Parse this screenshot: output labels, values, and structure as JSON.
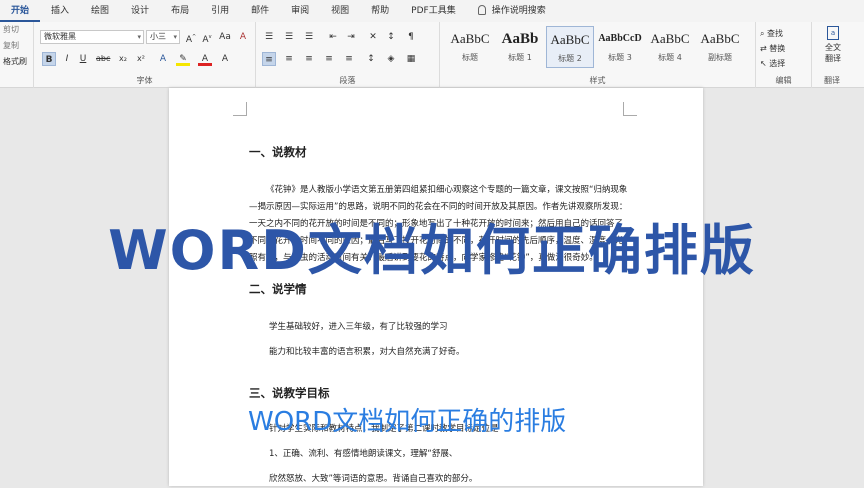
{
  "tabs": [
    "开始",
    "插入",
    "绘图",
    "设计",
    "布局",
    "引用",
    "邮件",
    "审阅",
    "视图",
    "帮助",
    "PDF工具集",
    "操作说明搜索"
  ],
  "clipboard": {
    "cut": "剪切",
    "copy": "复制",
    "format_painter": "格式刷"
  },
  "font": {
    "name": "微软雅黑",
    "size": "小三",
    "group_label": "字体"
  },
  "paragraph": {
    "group_label": "段落"
  },
  "styles": {
    "group_label": "样式",
    "items": [
      {
        "sample": "AaBbC",
        "name": "标题"
      },
      {
        "sample": "AaBb",
        "name": "标题 1"
      },
      {
        "sample": "AaBbC",
        "name": "标题 2"
      },
      {
        "sample": "AaBbCcD",
        "name": "标题 3"
      },
      {
        "sample": "AaBbC",
        "name": "标题 4"
      },
      {
        "sample": "AaBbC",
        "name": "副标题"
      }
    ]
  },
  "editing": {
    "find": "查找",
    "replace": "替换",
    "select": "选择",
    "group_label": "编辑"
  },
  "translate": {
    "label1": "全文",
    "label2": "翻译",
    "group_label": "翻译"
  },
  "document": {
    "h1": "一、说教材",
    "p1": "《花钟》是人教版小学语文第五册第四组紧扣细心观察这个专题的一篇文章，课文按照“归纳现象—揭示原因—实际运用”的思路，说明不同的花会在不同的时间开放及其原因。作者先讲观察所发现：一天之内不同的花开放的时间是不同的；形象地写出了十种花开放的时间来；然后用自己的话回答了不同的花开放时间不同的原因；最后写了按开花时间的不同，花开时间的先后顺序，温度、湿度、光照有关，与昆虫的活动时间有关。最后讲到要花的特点，向学家修建“花钟”，真做法很奇妙。",
    "h2": "二、说学情",
    "p2a": "学生基础较好，进入三年级，有了比较强的学习",
    "p2b": "能力和比较丰富的语言积累，对大自然充满了好奇。",
    "h3": "三、说教学目标",
    "p3a": "针对学生实际和教材特点，我制定了第二课时教学目标定位是",
    "p3b": "1、正确、流利、有感情地朗读课文，理解“舒展、",
    "p3c": "欣然怒放、大致”等词语的意思。背诵自己喜欢的部分。"
  },
  "overlay": {
    "title": "WORD文档如何正确排版",
    "subtitle": "WORD文档如何正确的排版"
  }
}
